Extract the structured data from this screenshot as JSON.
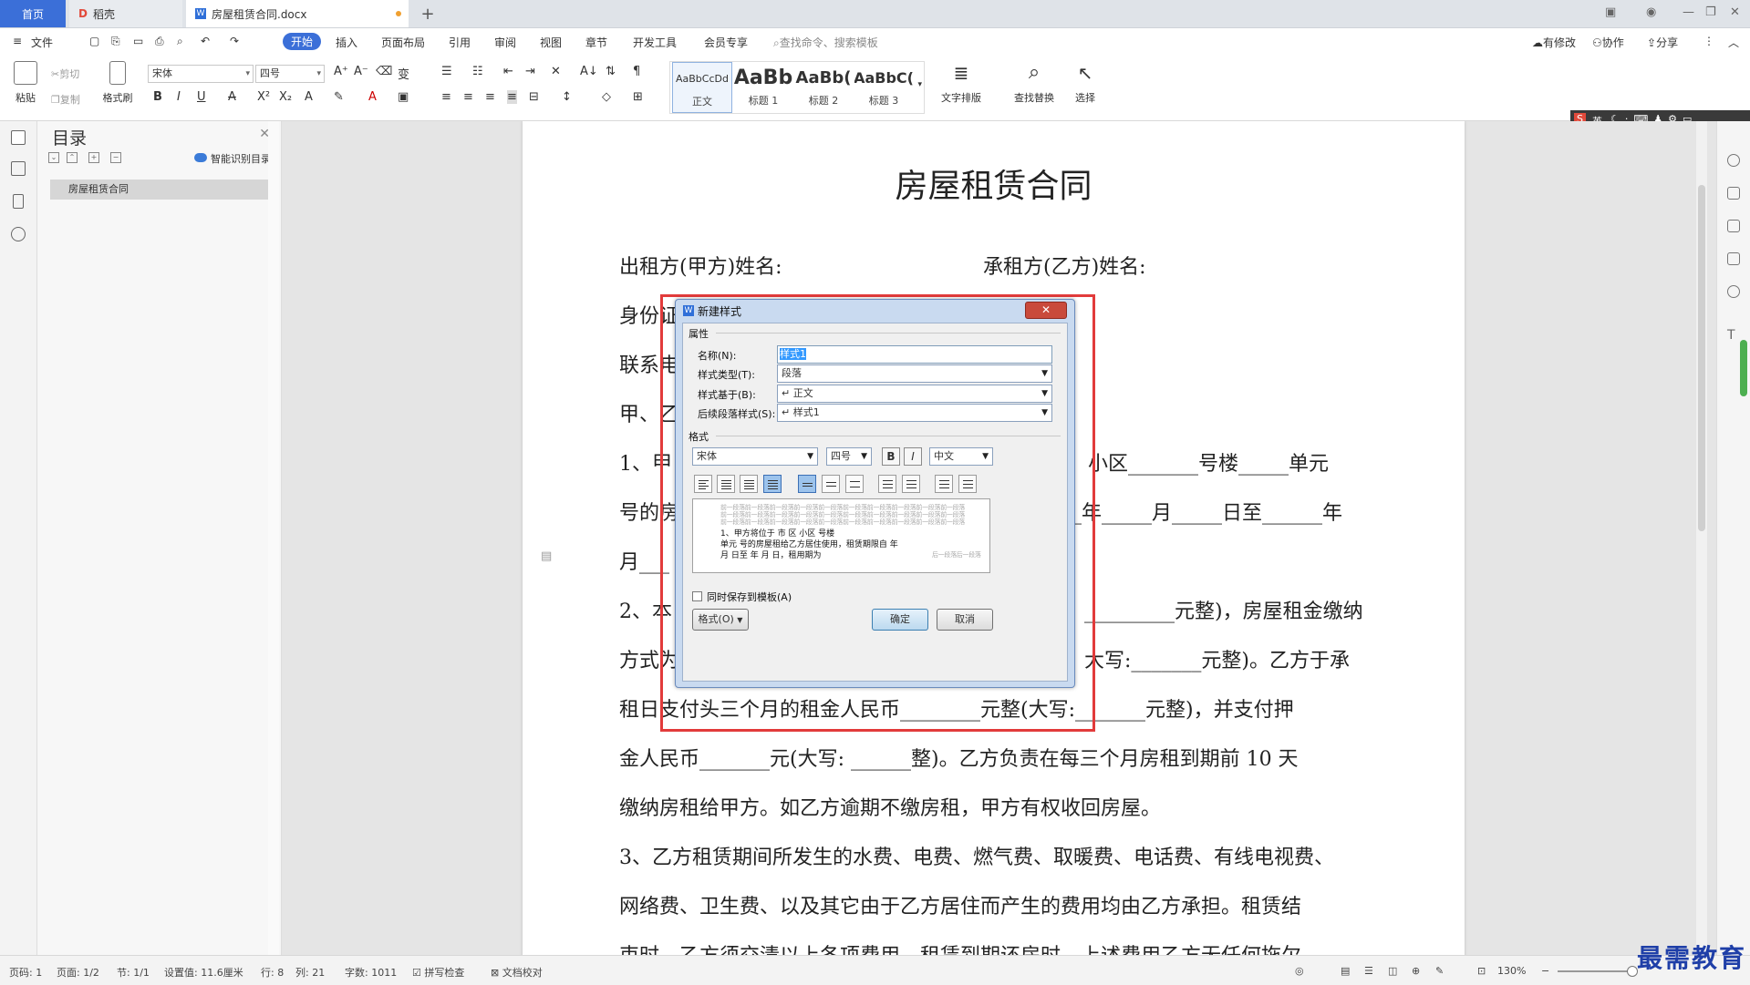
{
  "tabs": {
    "home": "首页",
    "docer": "稻壳",
    "document": "房屋租赁合同.docx",
    "add": "+"
  },
  "menu": {
    "file": "文件",
    "items": [
      "开始",
      "插入",
      "页面布局",
      "引用",
      "审阅",
      "视图",
      "章节",
      "开发工具",
      "会员专享"
    ],
    "search_placeholder": "查找命令、搜索模板",
    "revise": "有修改",
    "collab": "协作",
    "share": "分享"
  },
  "ribbon": {
    "paste": "粘贴",
    "cut": "剪切",
    "copy": "复制",
    "format_painter": "格式刷",
    "font_name": "宋体",
    "font_size": "四号",
    "styles": [
      {
        "sample": "AaBbCcDd",
        "label": "正文"
      },
      {
        "sample": "AaBb",
        "label": "标题 1"
      },
      {
        "sample": "AaBb(",
        "label": "标题 2"
      },
      {
        "sample": "AaBbC(",
        "label": "标题 3"
      }
    ],
    "text_layout": "文字排版",
    "find_replace": "查找替换",
    "select": "选择"
  },
  "toc": {
    "title": "目录",
    "smart": "智能识别目录",
    "items": [
      "房屋租赁合同"
    ]
  },
  "document": {
    "title": "房屋租赁合同",
    "lines": [
      "出租方(甲方)姓名:",
      "承租方(乙方)姓名:",
      "身份证",
      "联系电",
      "甲、乙",
      "1、甲",
      "小区_______号楼_____单元",
      "号的房",
      "_年_____月_____日至______年",
      "月___",
      "2、本",
      "_________元整)，房屋租金缴纳",
      "方式为",
      "大写:_______元整)。乙方于承",
      "租日支付头三个月的租金人民币________元整(大写:_______元整)，并支付押",
      "金人民币_______元(大写: ______整)。乙方负责在每三个月房租到期前 10 天",
      "缴纳房租给甲方。如乙方逾期不缴房租，甲方有权收回房屋。",
      "3、乙方租赁期间所发生的水费、电费、燃气费、取暖费、电话费、有线电视费、",
      "网络费、卫生费、以及其它由于乙方居住而产生的费用均由乙方承担。租赁结",
      "束时，乙方须交清以上各项费用。租赁到期还房时，上述费用乙方无任何拖欠"
    ]
  },
  "dialog": {
    "title": "新建样式",
    "section_props": "属性",
    "name_label": "名称(N):",
    "name_value": "样式1",
    "type_label": "样式类型(T):",
    "type_value": "段落",
    "based_label": "样式基于(B):",
    "based_value": "↵ 正文",
    "next_label": "后续段落样式(S):",
    "next_value": "↵ 样式1",
    "section_format": "格式",
    "font": "宋体",
    "size": "四号",
    "bold": "B",
    "italic": "I",
    "lang": "中文",
    "preview_prev": "前一段落前一段落前一段落前一段落前一段落前一段落前一段落前一段落前一段落前一段落",
    "preview_line1": "1、甲方将位于          市          区          小区          号楼",
    "preview_line2": "单元          号的房屋租给乙方居住使用，租赁期限自          年",
    "preview_line3": "月     日至          年          月          日，租用期为",
    "preview_next": "后一段落后一段落",
    "save_template": "同时保存到模板(A)",
    "format_btn": "格式(O)",
    "ok": "确定",
    "cancel": "取消"
  },
  "status": {
    "page_num": "页码: 1",
    "pages": "页面: 1/2",
    "section": "节: 1/1",
    "setting": "设置值: 11.6厘米",
    "row": "行: 8",
    "col": "列: 21",
    "words": "字数: 1011",
    "spell": "拼写检查",
    "proof": "文档校对",
    "zoom": "130%"
  },
  "watermark": "最需教育",
  "ime": "英"
}
